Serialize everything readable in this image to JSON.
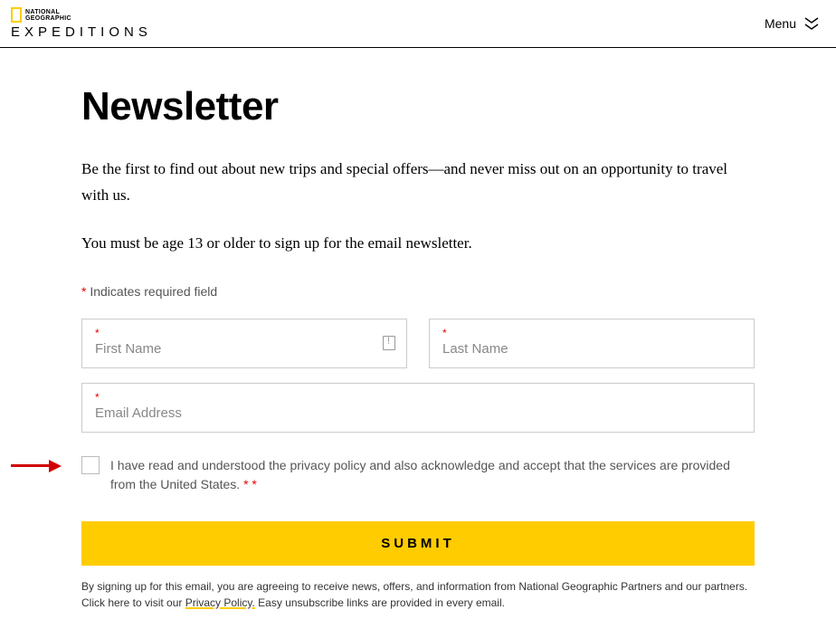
{
  "header": {
    "brand_line1": "NATIONAL",
    "brand_line2": "GEOGRAPHIC",
    "brand_line3": "EXPEDITIONS",
    "menu_label": "Menu"
  },
  "page": {
    "title": "Newsletter",
    "intro": "Be the first to find out about new trips and special offers—and never miss out on an opportunity to travel with us.",
    "age_note": "You must be age 13 or older to sign up for the email newsletter.",
    "required_note": "Indicates required field"
  },
  "form": {
    "first_name": {
      "placeholder": "First Name",
      "value": ""
    },
    "last_name": {
      "placeholder": "Last Name",
      "value": ""
    },
    "email": {
      "placeholder": "Email Address",
      "value": ""
    },
    "consent_text": "I have read and understood the privacy policy and also acknowledge and accept that the services are provided from the United States. ",
    "submit_label": "SUBMIT"
  },
  "footer": {
    "text_before": "By signing up for this email, you are agreeing to receive news, offers, and information from National Geographic Partners and our partners. Click here to visit our ",
    "link_label": "Privacy Policy.",
    "text_after": " Easy unsubscribe links are provided in every email."
  }
}
